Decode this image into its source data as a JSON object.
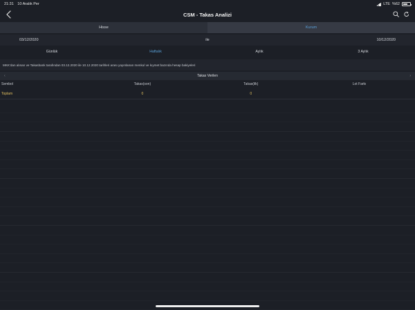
{
  "status_bar": {
    "time": "21:31",
    "date": "10 Aralık Per",
    "network": "LTE",
    "battery": "%62",
    "battery_level": 0.62
  },
  "nav": {
    "title": "CSM - Takas Analizi"
  },
  "segment": {
    "hisse": "Hisse",
    "kurum": "Kurum",
    "selected": "Kurum"
  },
  "date_range": {
    "start": "03/12/2020",
    "connector": "ile",
    "end": "10/12/2020"
  },
  "periods": [
    {
      "label": "Günlük"
    },
    {
      "label": "Haftalık"
    },
    {
      "label": "Aylık"
    },
    {
      "label": "3 Aylık"
    }
  ],
  "selected_period": "Haftalık",
  "info_text": "MKK'dan alınan ve Takasbank tarafından 03.12.2020 ile 10.12.2020 tarihleri arası yayınlanan menkul ve kıymet bazında hesap bakiyeleri",
  "table": {
    "title": "Takas Verilen",
    "prev_arrow": "‹",
    "next_arrow": "›",
    "columns": [
      "Sembol",
      "Takas(son)",
      "Takas(ilk)",
      "Lot Farkı"
    ],
    "total_row": {
      "label": "Toplam",
      "takas_son": "0",
      "takas_ilk": "0",
      "lot_farki": ""
    }
  }
}
